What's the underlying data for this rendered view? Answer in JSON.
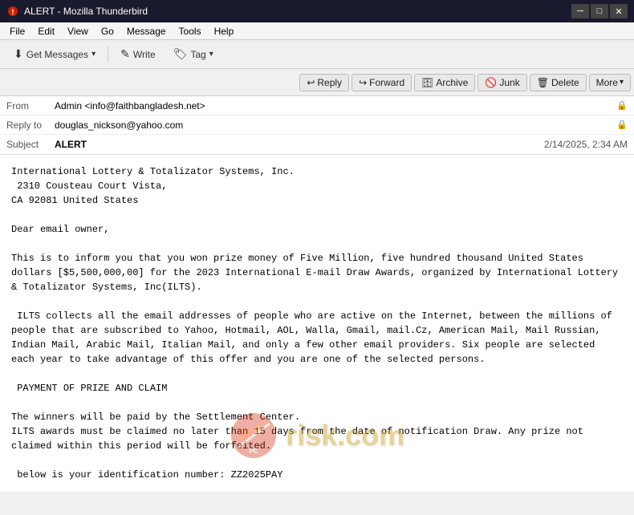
{
  "window": {
    "title": "ALERT - Mozilla Thunderbird",
    "minimize_label": "─",
    "maximize_label": "□",
    "close_label": "✕"
  },
  "menu": {
    "items": [
      "File",
      "Edit",
      "View",
      "Go",
      "Message",
      "Tools",
      "Help"
    ]
  },
  "toolbar": {
    "get_messages_label": "Get Messages",
    "write_label": "Write",
    "tag_label": "Tag"
  },
  "actions": {
    "reply_label": "Reply",
    "forward_label": "Forward",
    "archive_label": "Archive",
    "junk_label": "Junk",
    "delete_label": "Delete",
    "more_label": "More"
  },
  "email": {
    "from_label": "From",
    "from_value": "Admin <info@faithbangladesh.net>",
    "reply_to_label": "Reply to",
    "reply_to_value": "douglas_nickson@yahoo.com",
    "subject_label": "Subject",
    "subject_value": "ALERT",
    "date_value": "2/14/2025, 2:34 AM",
    "body": "International Lottery & Totalizator Systems, Inc.\n 2310 Cousteau Court Vista,\nCA 92081 United States\n\nDear email owner,\n\nThis is to inform you that you won prize money of Five Million, five hundred thousand United States dollars [$5,500,000,00] for the 2023 International E-mail Draw Awards, organized by International Lottery & Totalizator Systems, Inc(ILTS).\n\n ILTS collects all the email addresses of people who are active on the Internet, between the millions of people that are subscribed to Yahoo, Hotmail, AOL, Walla, Gmail, mail.Cz, American Mail, Mail Russian, Indian Mail, Arabic Mail, Italian Mail, and only a few other email providers. Six people are selected each year to take advantage of this offer and you are one of the selected persons.\n\n PAYMENT OF PRIZE AND CLAIM\n\nThe winners will be paid by the Settlement Center.\nILTS awards must be claimed no later than 15 days from the date of notification Draw. Any prize not claimed within this period will be forfeited.\n\n below is your identification number: ZZ2025PAY"
  },
  "watermark": {
    "text": "risk.com"
  }
}
